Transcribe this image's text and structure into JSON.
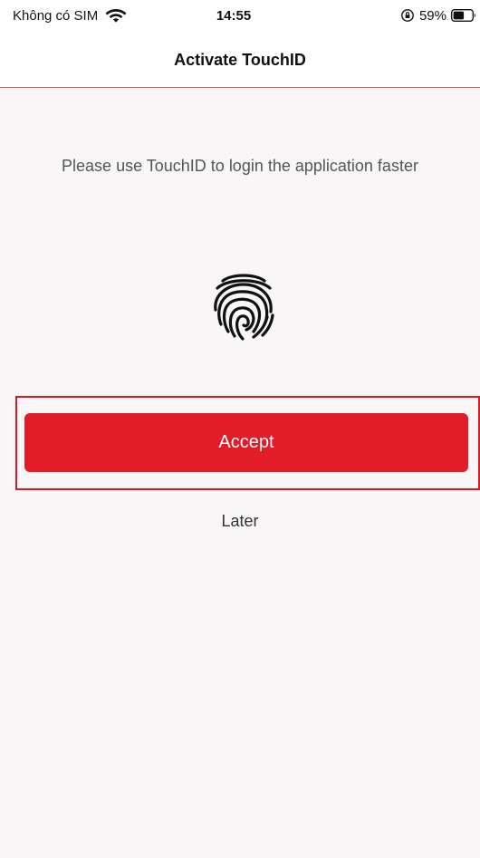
{
  "status_bar": {
    "carrier": "Không có SIM",
    "time": "14:55",
    "battery_percent": "59%",
    "wifi_icon": "wifi-icon",
    "orientation_lock_icon": "orientation-lock-icon",
    "battery_icon": "battery-icon"
  },
  "header": {
    "title": "Activate TouchID"
  },
  "main": {
    "message": "Please use TouchID to login the application faster",
    "fingerprint_icon": "fingerprint-icon",
    "accept_label": "Accept",
    "later_label": "Later"
  },
  "colors": {
    "accent": "#e21d27",
    "header_divider": "#d9534f",
    "background": "#f8f6f7"
  }
}
